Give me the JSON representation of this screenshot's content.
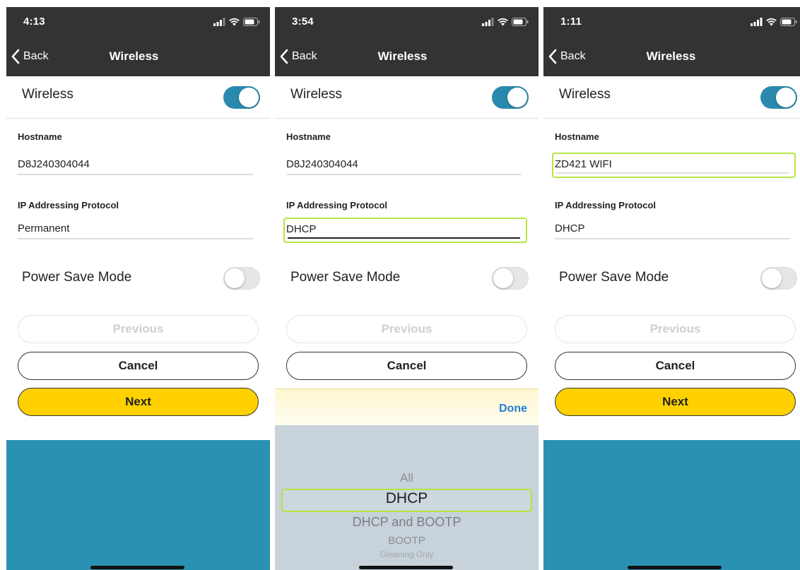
{
  "colors": {
    "header_bg": "#333333",
    "toggle_on": "#2a8aad",
    "next_button": "#ffd100",
    "footer_band": "#2b91b3",
    "focus_outline": "#b5e63f",
    "done_link": "#1f7fd1"
  },
  "icons": {
    "back": "chevron-left-icon",
    "signal": "cellular-signal-icon",
    "wifi": "wifi-icon",
    "battery": "battery-icon"
  },
  "screens": [
    {
      "status_time": "4:13",
      "nav": {
        "back_label": "Back",
        "title": "Wireless"
      },
      "wireless": {
        "label": "Wireless",
        "enabled": true
      },
      "hostname": {
        "label": "Hostname",
        "value": "D8J240304044"
      },
      "ip_protocol": {
        "label": "IP Addressing Protocol",
        "value": "Permanent"
      },
      "power_save": {
        "label": "Power Save Mode",
        "enabled": false
      },
      "buttons": {
        "previous": "Previous",
        "cancel": "Cancel",
        "next": "Next"
      }
    },
    {
      "status_time": "3:54",
      "nav": {
        "back_label": "Back",
        "title": "Wireless"
      },
      "wireless": {
        "label": "Wireless",
        "enabled": true
      },
      "hostname": {
        "label": "Hostname",
        "value": "D8J240304044"
      },
      "ip_protocol": {
        "label": "IP Addressing Protocol",
        "value": "DHCP"
      },
      "power_save": {
        "label": "Power Save Mode",
        "enabled": false
      },
      "buttons": {
        "previous": "Previous",
        "cancel": "Cancel"
      },
      "picker": {
        "done_label": "Done",
        "options": [
          "All",
          "DHCP",
          "DHCP and BOOTP",
          "BOOTP",
          "Gleaning Only"
        ],
        "selected": "DHCP"
      }
    },
    {
      "status_time": "1:11",
      "nav": {
        "back_label": "Back",
        "title": "Wireless"
      },
      "wireless": {
        "label": "Wireless",
        "enabled": true
      },
      "hostname": {
        "label": "Hostname",
        "value": "ZD421 WIFI"
      },
      "ip_protocol": {
        "label": "IP Addressing Protocol",
        "value": "DHCP"
      },
      "power_save": {
        "label": "Power Save Mode",
        "enabled": false
      },
      "buttons": {
        "previous": "Previous",
        "cancel": "Cancel",
        "next": "Next"
      }
    }
  ]
}
